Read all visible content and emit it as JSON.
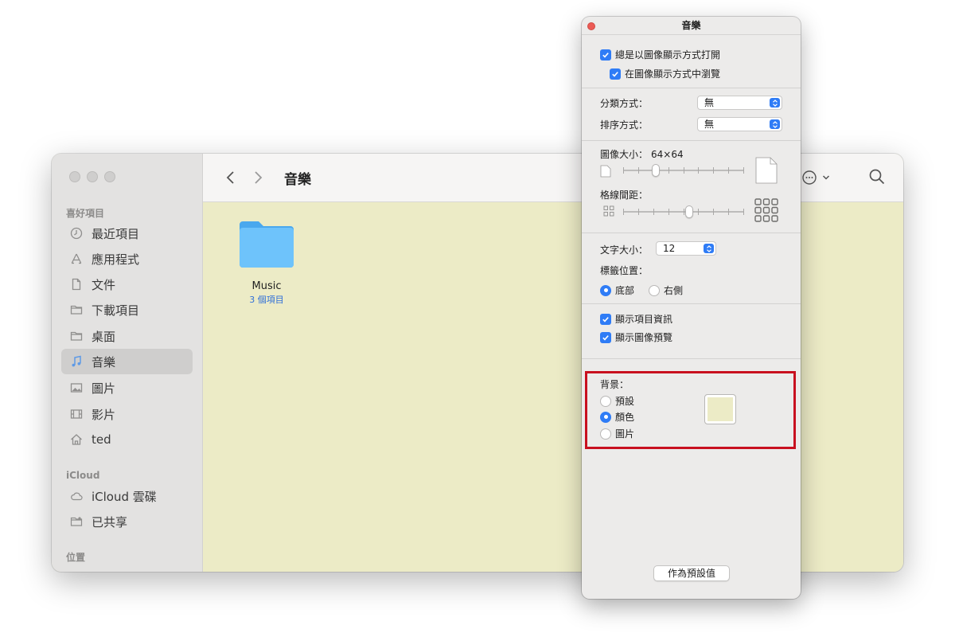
{
  "finder": {
    "title": "音樂",
    "sidebar": {
      "favorites_heading": "喜好項目",
      "favorites": [
        {
          "label": "最近項目",
          "icon": "clock-icon"
        },
        {
          "label": "應用程式",
          "icon": "apps-icon"
        },
        {
          "label": "文件",
          "icon": "document-icon"
        },
        {
          "label": "下載項目",
          "icon": "folder-icon"
        },
        {
          "label": "桌面",
          "icon": "folder-icon"
        },
        {
          "label": "音樂",
          "icon": "music-note-icon",
          "selected": true
        },
        {
          "label": "圖片",
          "icon": "photo-icon"
        },
        {
          "label": "影片",
          "icon": "film-icon"
        },
        {
          "label": "ted",
          "icon": "home-icon"
        }
      ],
      "icloud_heading": "iCloud",
      "icloud": [
        {
          "label": "iCloud 雲碟",
          "icon": "cloud-icon"
        },
        {
          "label": "已共享",
          "icon": "shared-folder-icon"
        }
      ],
      "locations_heading": "位置"
    },
    "content": {
      "items": [
        {
          "name": "Music",
          "count": "3 個項目",
          "icon": "folder-icon"
        }
      ],
      "background_color": "#ecebc6"
    }
  },
  "panel": {
    "title": "音樂",
    "always_open_icon_view": "總是以圖像顯示方式打開",
    "browse_icon_view": "在圖像顯示方式中瀏覽",
    "group_by_label": "分類方式：",
    "group_by_value": "無",
    "sort_by_label": "排序方式：",
    "sort_by_value": "無",
    "icon_size_label": "圖像大小：",
    "icon_size_value": "64×64",
    "icon_size_level": 0.25,
    "grid_spacing_label": "格線間距：",
    "grid_spacing_level": 0.55,
    "text_size_label": "文字大小：",
    "text_size_value": "12",
    "label_position_label": "標籤位置：",
    "label_bottom": "底部",
    "label_right": "右側",
    "show_item_info": "顯示項目資訊",
    "show_icon_preview": "顯示圖像預覽",
    "background_label": "背景：",
    "bg_default": "預設",
    "bg_color": "顏色",
    "bg_picture": "圖片",
    "use_as_defaults": "作為預設值",
    "swatch_color": "#ecebc6",
    "accent_color": "#2f7cf6"
  }
}
